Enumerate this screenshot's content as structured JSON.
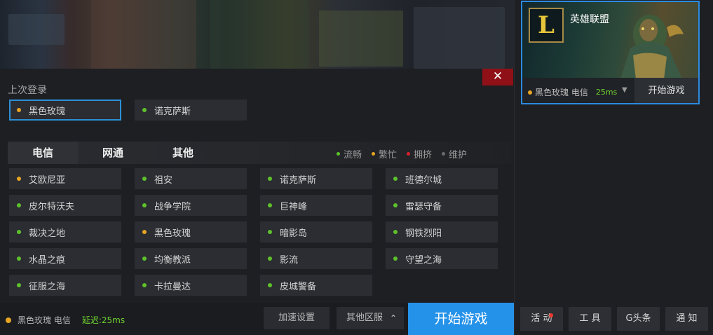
{
  "popup": {
    "close_label": "✕",
    "last_login_title": "上次登录",
    "last_login": [
      {
        "name": "黑色玫瑰",
        "status": "orange",
        "selected": true
      },
      {
        "name": "诺克萨斯",
        "status": "green",
        "selected": false
      }
    ],
    "tabs": [
      {
        "label": "电信",
        "active": true
      },
      {
        "label": "网通",
        "active": false
      },
      {
        "label": "其他",
        "active": false
      }
    ],
    "legend": [
      {
        "label": "流畅",
        "color": "green"
      },
      {
        "label": "繁忙",
        "color": "orange"
      },
      {
        "label": "拥挤",
        "color": "red"
      },
      {
        "label": "维护",
        "color": "gray"
      }
    ],
    "servers": [
      [
        "艾欧尼亚",
        "orange"
      ],
      [
        "祖安",
        "green"
      ],
      [
        "诺克萨斯",
        "green"
      ],
      [
        "班德尔城",
        "green"
      ],
      [
        "皮尔特沃夫",
        "green"
      ],
      [
        "战争学院",
        "green"
      ],
      [
        "巨神峰",
        "green"
      ],
      [
        "雷瑟守备",
        "green"
      ],
      [
        "裁决之地",
        "green"
      ],
      [
        "黑色玫瑰",
        "orange"
      ],
      [
        "暗影岛",
        "green"
      ],
      [
        "钢铁烈阳",
        "green"
      ],
      [
        "水晶之痕",
        "green"
      ],
      [
        "均衡教派",
        "green"
      ],
      [
        "影流",
        "green"
      ],
      [
        "守望之海",
        "green"
      ],
      [
        "征服之海",
        "green"
      ],
      [
        "卡拉曼达",
        "green"
      ],
      [
        "皮城警备",
        "green"
      ]
    ]
  },
  "bottom_bar": {
    "current_server": "黑色玫瑰 电信",
    "latency": "延迟:25ms",
    "accel_settings": "加速设置",
    "other_regions": "其他区服",
    "arrow": "⌃",
    "start_label": "开始游戏"
  },
  "game_card": {
    "title": "英雄联盟",
    "logo_letter": "L",
    "server": "黑色玫瑰 电信",
    "latency": "25ms",
    "chevron": "▼",
    "start_label": "开始游戏"
  },
  "tools": [
    {
      "label": "活 动",
      "badge": true
    },
    {
      "label": "工 具",
      "badge": false
    },
    {
      "label": "G头条",
      "badge": false
    },
    {
      "label": "通 知",
      "badge": false
    }
  ]
}
